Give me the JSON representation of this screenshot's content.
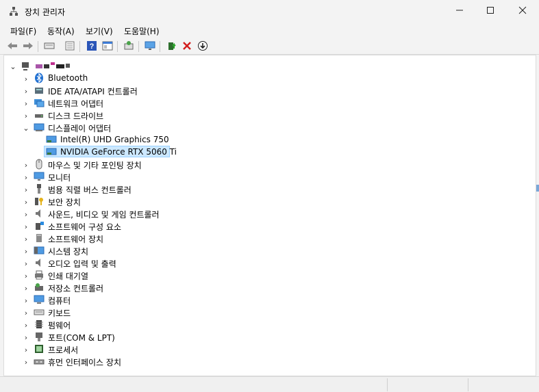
{
  "window": {
    "title": "장치 관리자"
  },
  "menu": [
    "파일(F)",
    "동작(A)",
    "보기(V)",
    "도움말(H)"
  ],
  "toolbar": {
    "buttons": [
      "back-icon",
      "forward-icon",
      "show-hidden-icon",
      "properties-icon",
      "help-icon",
      "view-icon",
      "scan-hardware-icon",
      "monitor-icon",
      "update-driver-icon",
      "uninstall-icon",
      "disable-icon"
    ]
  },
  "tree": {
    "root_label": "",
    "categories": [
      {
        "label": "Bluetooth"
      },
      {
        "label": "IDE ATA/ATAPI 컨트롤러"
      },
      {
        "label": "네트워크 어댑터"
      },
      {
        "label": "디스크 드라이브"
      },
      {
        "label": "디스플레이 어댑터"
      },
      {
        "label": "마우스 및 기타 포인팅 장치"
      },
      {
        "label": "모니터"
      },
      {
        "label": "범용 직렬 버스 컨트롤러"
      },
      {
        "label": "보안 장치"
      },
      {
        "label": "사운드, 비디오 및 게임 컨트롤러"
      },
      {
        "label": "소프트웨어 구성 요소"
      },
      {
        "label": "소프트웨어 장치"
      },
      {
        "label": "시스템 장치"
      },
      {
        "label": "오디오 입력 및 출력"
      },
      {
        "label": "인쇄 대기열"
      },
      {
        "label": "저장소 컨트롤러"
      },
      {
        "label": "컴퓨터"
      },
      {
        "label": "키보드"
      },
      {
        "label": "펌웨어"
      },
      {
        "label": "포트(COM & LPT)"
      },
      {
        "label": "프로세서"
      },
      {
        "label": "휴먼 인터페이스 장치"
      }
    ],
    "display_children": [
      {
        "label": "Intel(R) UHD Graphics 750"
      },
      {
        "label": "NVIDIA GeForce RTX 5060 Ti",
        "selected": true
      }
    ]
  },
  "colors": {
    "selection_bg": "#cce8ff",
    "selection_border": "#99d1ff",
    "accent_blue": "#1e6fd6"
  }
}
